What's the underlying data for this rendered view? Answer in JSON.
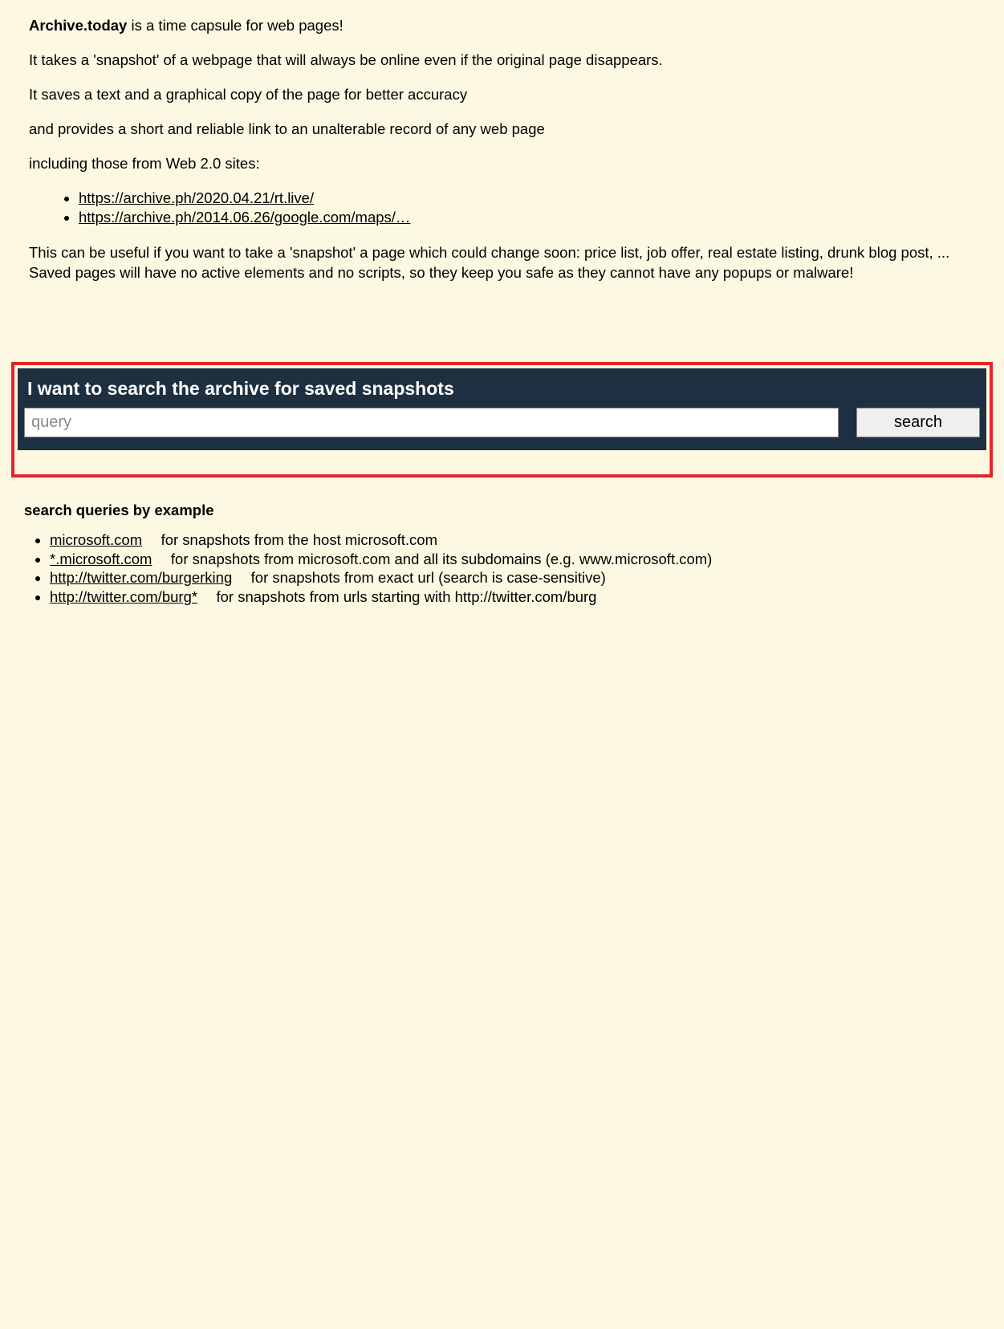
{
  "intro": {
    "site_name": "Archive.today",
    "tagline_after_name": " is a time capsule for web pages!",
    "line2": "It takes a 'snapshot' of a webpage that will always be online even if the original page disappears.",
    "line3": "It saves a text and a graphical copy of the page for better accuracy",
    "line4": "and provides a short and reliable link to an unalterable record of any web page",
    "line5": "including those from Web 2.0 sites:"
  },
  "example_links": [
    "https://archive.ph/2020.04.21/rt.live/",
    "https://archive.ph/2014.06.26/google.com/maps/…"
  ],
  "intro_tail": {
    "useful_line": "This can be useful if you want to take a 'snapshot' a page which could change soon: price list, job offer, real estate listing, drunk blog post, ...",
    "safety_line": "Saved pages will have no active elements and no scripts, so they keep you safe as they cannot have any popups or malware!"
  },
  "search": {
    "heading": "I want to search the archive for saved snapshots",
    "placeholder": "query",
    "value": "",
    "button_label": "search"
  },
  "examples": {
    "heading": "search queries by example",
    "items": [
      {
        "query": "microsoft.com",
        "desc": "for snapshots from the host microsoft.com"
      },
      {
        "query": "*.microsoft.com",
        "desc": "for snapshots from microsoft.com and all its subdomains (e.g. www.microsoft.com)"
      },
      {
        "query": "http://twitter.com/burgerking",
        "desc": "for snapshots from exact url (search is case-sensitive)"
      },
      {
        "query": "http://twitter.com/burg*",
        "desc": "for snapshots from urls starting with http://twitter.com/burg"
      }
    ]
  }
}
